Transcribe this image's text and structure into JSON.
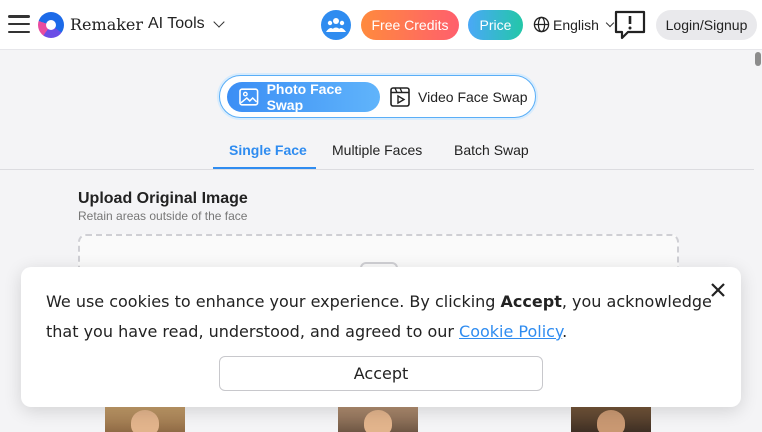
{
  "header": {
    "brand": "Remaker",
    "ai_tools_label": "AI Tools",
    "free_credits_label": "Free Credits",
    "price_label": "Price",
    "language_label": "English",
    "login_label": "Login/Signup",
    "colors": {
      "accent": "#2f8cf0",
      "free_credits_gradient": [
        "#ff8a3d",
        "#ff5f6d"
      ],
      "price_gradient": [
        "#4aa8f7",
        "#23c7a8"
      ]
    }
  },
  "swap_mode": {
    "photo_label": "Photo Face Swap",
    "video_label": "Video Face Swap",
    "selected": "photo"
  },
  "tabs": [
    {
      "label": "Single Face",
      "active": true
    },
    {
      "label": "Multiple Faces",
      "active": false
    },
    {
      "label": "Batch Swap",
      "active": false
    }
  ],
  "upload": {
    "title": "Upload Original Image",
    "subtitle": "Retain areas outside of the face"
  },
  "cookie": {
    "text_part1": "We use cookies to enhance your experience. By clicking ",
    "accept_word": "Accept",
    "text_part2": ", you acknowledge that you have read, understood, and agreed to our ",
    "policy_link": "Cookie Policy",
    "text_end": ".",
    "accept_button": "Accept"
  }
}
